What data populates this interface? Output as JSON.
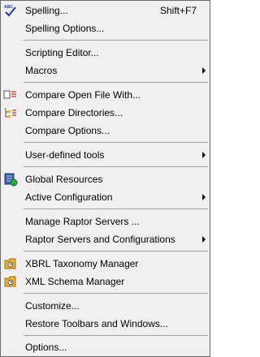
{
  "menu": {
    "items": [
      {
        "label": "Spelling...",
        "shortcut": "Shift+F7",
        "icon": "spell-check-icon"
      },
      {
        "label": "Spelling Options..."
      },
      {
        "label": "Scripting Editor..."
      },
      {
        "label": "Macros",
        "submenu": true
      },
      {
        "label": "Compare Open File With...",
        "icon": "compare-file-icon"
      },
      {
        "label": "Compare Directories...",
        "icon": "compare-directories-icon"
      },
      {
        "label": "Compare Options..."
      },
      {
        "label": "User-defined tools",
        "submenu": true
      },
      {
        "label": "Global Resources",
        "icon": "global-resources-icon"
      },
      {
        "label": "Active Configuration",
        "submenu": true
      },
      {
        "label": "Manage Raptor Servers ..."
      },
      {
        "label": "Raptor Servers and Configurations",
        "submenu": true
      },
      {
        "label": "XBRL Taxonomy Manager",
        "icon": "xbrl-taxonomy-manager-icon"
      },
      {
        "label": "XML Schema Manager",
        "icon": "xml-schema-manager-icon"
      },
      {
        "label": "Customize..."
      },
      {
        "label": "Restore Toolbars and Windows..."
      },
      {
        "label": "Options..."
      }
    ]
  }
}
